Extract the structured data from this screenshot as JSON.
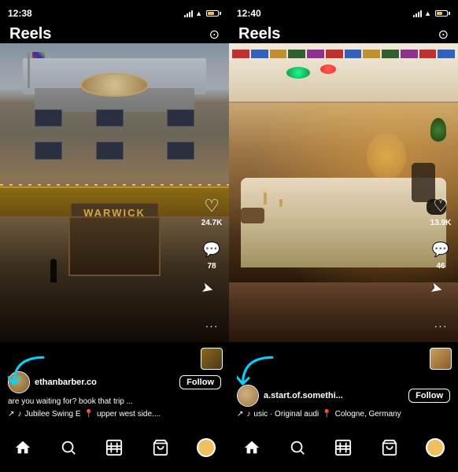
{
  "left_phone": {
    "status_time": "12:38",
    "header_title": "Reels",
    "likes_count": "24.7K",
    "comments_count": "78",
    "username": "ethanbarber.co",
    "follow_label": "Follow",
    "caption": "are you waiting for? book that trip ...",
    "music": "Jubilee Swing E",
    "music_tag": "upper west side....",
    "camera_icon": "📷"
  },
  "right_phone": {
    "status_time": "12:40",
    "header_title": "Reels",
    "likes_count": "13.9K",
    "comments_count": "46",
    "username": "a.start.of.somethi...",
    "follow_label": "Follow",
    "music": "usic · Original audi",
    "location": "Cologne, Germany",
    "camera_icon": "📷"
  },
  "nav": {
    "home": "⌂",
    "search": "🔍",
    "reels": "▶",
    "shop": "🛍",
    "profile": ""
  },
  "icons": {
    "heart": "♡",
    "comment": "💬",
    "share": "➤",
    "more": "···",
    "music_note": "♪",
    "location_pin": "📍",
    "camera": "⊙"
  }
}
